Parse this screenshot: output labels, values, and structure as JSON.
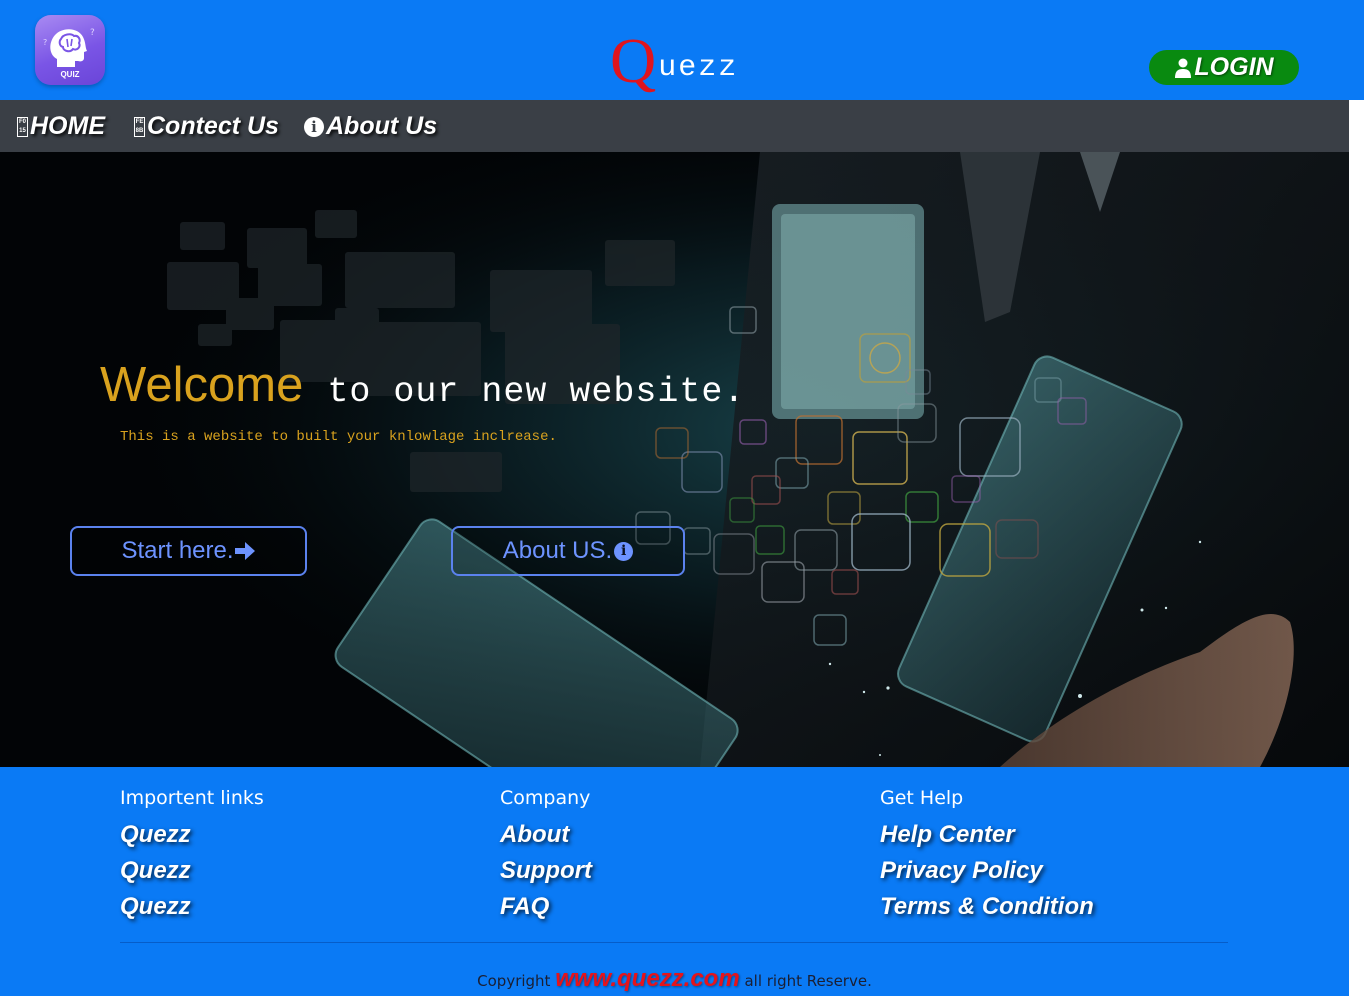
{
  "header": {
    "logo_text": "QUIZ",
    "logo_icon": "brain-head-icon",
    "brand_initial": "Q",
    "brand_rest": "uezz",
    "login_label": "LOGIN",
    "login_icon": "user-icon"
  },
  "nav": {
    "items": [
      {
        "label": "HOME",
        "icon": "missing-glyph-box"
      },
      {
        "label": "Contect Us",
        "icon": "missing-glyph-box"
      },
      {
        "label": "About Us",
        "icon": "info-circle-icon"
      }
    ]
  },
  "hero": {
    "welcome_word": "Welcome",
    "welcome_rest": "to our new website.",
    "tagline": "This is a website to built your knlowlage inclrease.",
    "start_button": "Start here.",
    "about_button": "About US."
  },
  "footer": {
    "columns": [
      {
        "title": "Importent links",
        "links": [
          "Quezz",
          "Quezz",
          "Quezz"
        ]
      },
      {
        "title": "Company",
        "links": [
          "About",
          "Support",
          "FAQ"
        ]
      },
      {
        "title": "Get Help",
        "links": [
          "Help Center",
          "Privacy Policy",
          "Terms & Condition"
        ]
      }
    ],
    "copyright_prefix": "Copyright",
    "copyright_site": "www.quezz.com",
    "copyright_suffix": "all right Reserve."
  },
  "colors": {
    "header_bg": "#0a7af5",
    "nav_bg": "#3a3f46",
    "login_bg": "#098a10",
    "accent_gold": "#d9a21e",
    "brand_red": "#e0141e",
    "button_blue": "#5b82ee"
  }
}
